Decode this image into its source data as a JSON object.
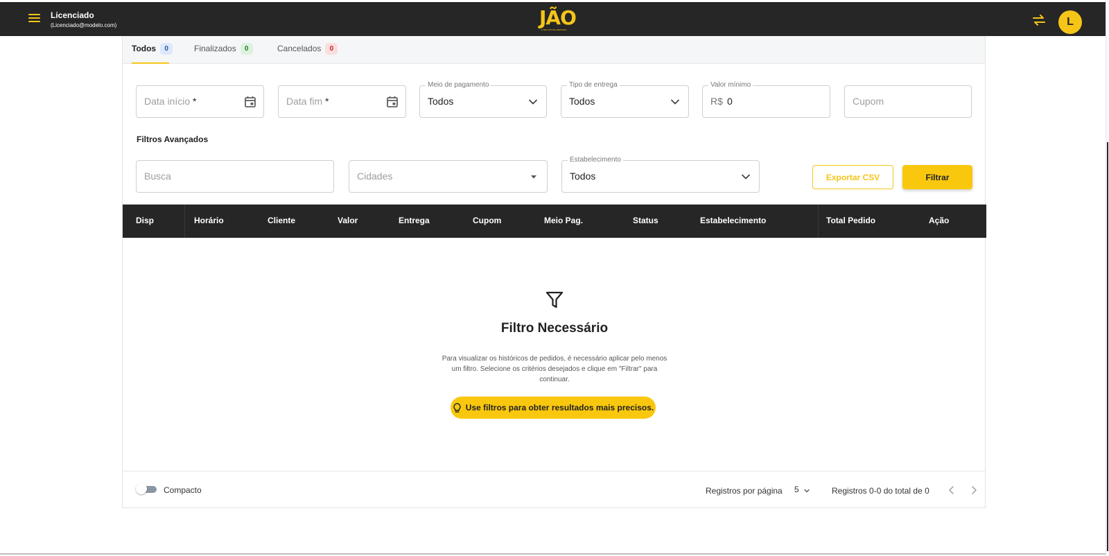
{
  "header": {
    "user_name": "Licenciado",
    "user_email": "(Licenciado@modelo.com)",
    "logo_text": "JÃO",
    "logo_subtitle": "O SEU APP DE MERCADO",
    "avatar_initial": "L"
  },
  "tabs": [
    {
      "label": "Todos",
      "count": "0",
      "active": true
    },
    {
      "label": "Finalizados",
      "count": "0"
    },
    {
      "label": "Cancelados",
      "count": "0"
    }
  ],
  "filters": {
    "date_start_placeholder": "Data início",
    "date_end_placeholder": "Data fim",
    "required_mark": "*",
    "payment": {
      "legend": "Meio de pagamento",
      "value": "Todos"
    },
    "delivery": {
      "legend": "Tipo de entrega",
      "value": "Todos"
    },
    "min_value": {
      "legend": "Valor mínimo",
      "prefix": "R$",
      "value": "0"
    },
    "coupon_placeholder": "Cupom",
    "advanced_title": "Filtros Avançados",
    "search_placeholder": "Busca",
    "cities_placeholder": "Cidades",
    "establishment": {
      "legend": "Estabelecimento",
      "value": "Todos"
    },
    "export_label": "Exportar CSV",
    "filter_label": "Filtrar"
  },
  "table": {
    "columns": [
      "Disp",
      "Horário",
      "Cliente",
      "Valor",
      "Entrega",
      "Cupom",
      "Meio Pag.",
      "Status",
      "Estabelecimento",
      "Total Pedido",
      "Ação"
    ]
  },
  "empty_state": {
    "title": "Filtro Necessário",
    "text": "Para visualizar os históricos de pedidos, é necessário aplicar pelo menos um filtro. Selecione os critérios desejados e clique em \"Filtrar\" para continuar.",
    "hint": "Use filtros para obter resultados mais precisos."
  },
  "footer": {
    "compact_label": "Compacto",
    "rows_per_page_label": "Registros por página",
    "rows_per_page_value": "5",
    "range_text": "Registros 0-0 do total de 0"
  },
  "colors": {
    "accent": "#f9c80e",
    "topbar": "#262626"
  },
  "icons": [
    "menu-icon",
    "swap-icon",
    "calendar-icon",
    "chevron-down-icon",
    "caret-down-icon",
    "filter-icon",
    "lightbulb-icon",
    "chevron-left-icon",
    "chevron-right-icon"
  ]
}
